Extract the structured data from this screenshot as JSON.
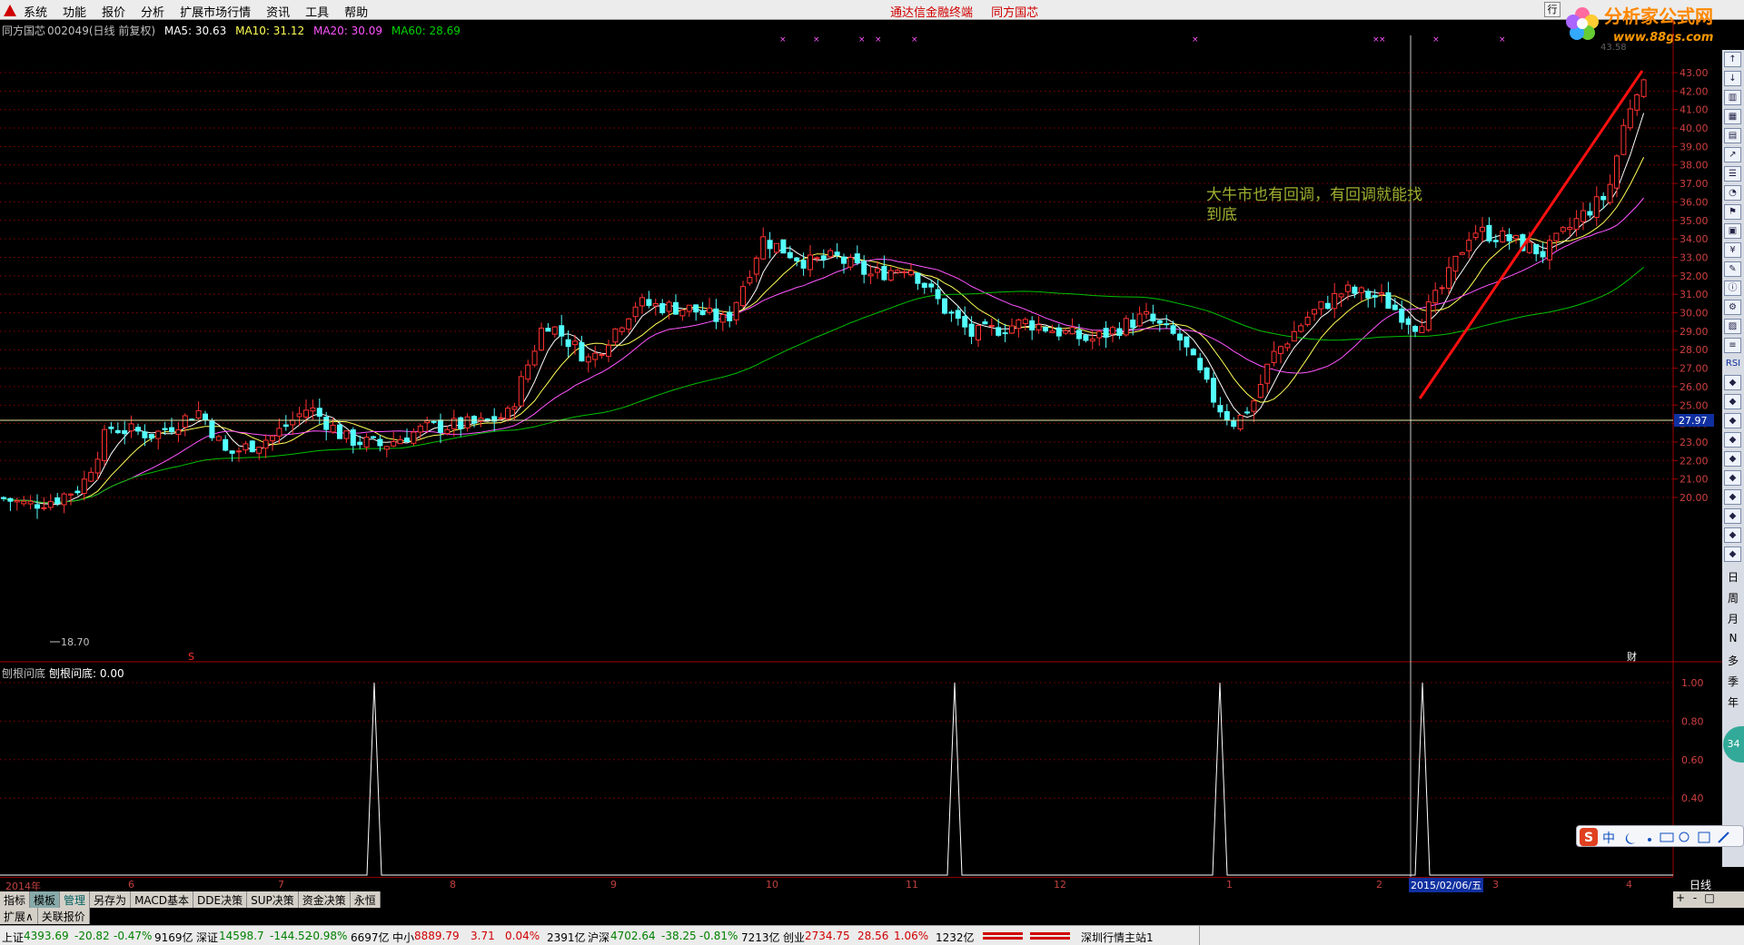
{
  "menubar": {
    "items": [
      "系统",
      "功能",
      "报价",
      "分析",
      "扩展市场行情",
      "资讯",
      "工具",
      "帮助"
    ],
    "center": [
      "通达信金融终端",
      "同方国芯"
    ],
    "right_glyph": "行"
  },
  "brand": {
    "name": "分析家公式网",
    "url": "www.88gs.com"
  },
  "quote": {
    "title": "同方国芯",
    "code": "002049(日线 前复权)",
    "ma5": "MA5: 30.63",
    "ma10": "MA10: 31.12",
    "ma20": "MA20: 30.09",
    "ma60": "MA60: 28.69"
  },
  "annotation": {
    "line1": "大牛市也有回调，有回调就能找",
    "line2": "到底"
  },
  "price_axis": {
    "labels": [
      "43.00",
      "42.00",
      "41.00",
      "40.00",
      "39.00",
      "38.00",
      "37.00",
      "36.00",
      "35.00",
      "34.00",
      "33.00",
      "32.00",
      "31.00",
      "30.00",
      "29.00",
      "28.00",
      "27.00",
      "26.00",
      "25.00",
      "24.00",
      "23.00",
      "22.00",
      "21.00",
      "20.00"
    ],
    "cursor_price": "27.97",
    "top_value": "43.58",
    "low_marker": "18.70",
    "cai_marker": "财",
    "s_marker": "S"
  },
  "indicator": {
    "name": "刨根问底",
    "value_label": "刨根问底: 0.00",
    "axis": [
      "1.00",
      "0.80",
      "0.60",
      "0.40"
    ]
  },
  "date_axis": {
    "labels": [
      "2014年",
      "6",
      "7",
      "8",
      "9",
      "10",
      "11",
      "12",
      "1",
      "2",
      "3",
      "4"
    ],
    "selected": "2015/02/06/五",
    "period": "日线"
  },
  "tabs": [
    "指标",
    "模板",
    "管理",
    "另存为",
    "MACD基本",
    "DDE决策",
    "SUP决策",
    "资金决策",
    "永恒"
  ],
  "tabs2": [
    "扩展∧",
    "关联报价"
  ],
  "tabbar_right": [
    "+",
    "-",
    "□"
  ],
  "right_toolbar": {
    "rsi": "RSI",
    "text_items": [
      "日",
      "周",
      "月",
      "N",
      "多",
      "季",
      "年"
    ]
  },
  "ime": {
    "label": "中"
  },
  "badge": "34",
  "status": {
    "sh": {
      "name": "上证",
      "price": "4393.69",
      "chg": "-20.82",
      "pct": "-0.47%",
      "amt": "9169亿"
    },
    "sz": {
      "name": "深证",
      "price": "14598.7",
      "chg": "-144.52",
      "pct": "-0.98%",
      "amt": "6697亿"
    },
    "zx": {
      "name": "中小",
      "price": "8889.79",
      "chg": "3.71",
      "pct": "0.04%",
      "amt": "2391亿"
    },
    "hs": {
      "name": "沪深",
      "price": "4702.64",
      "chg": "-38.25",
      "pct": "-0.81%",
      "amt": "7213亿"
    },
    "cy": {
      "name": "创业",
      "price": "2734.75",
      "chg": "28.56",
      "pct": "1.06%",
      "amt": "1232亿"
    },
    "server": "深圳行情主站1"
  },
  "colors": {
    "up": "#ff3232",
    "down": "#54ffff",
    "ma5": "#ffffff",
    "ma10": "#ffff55",
    "ma20": "#ff55ff",
    "ma60": "#00c000",
    "annotation": "#9faf30"
  }
}
